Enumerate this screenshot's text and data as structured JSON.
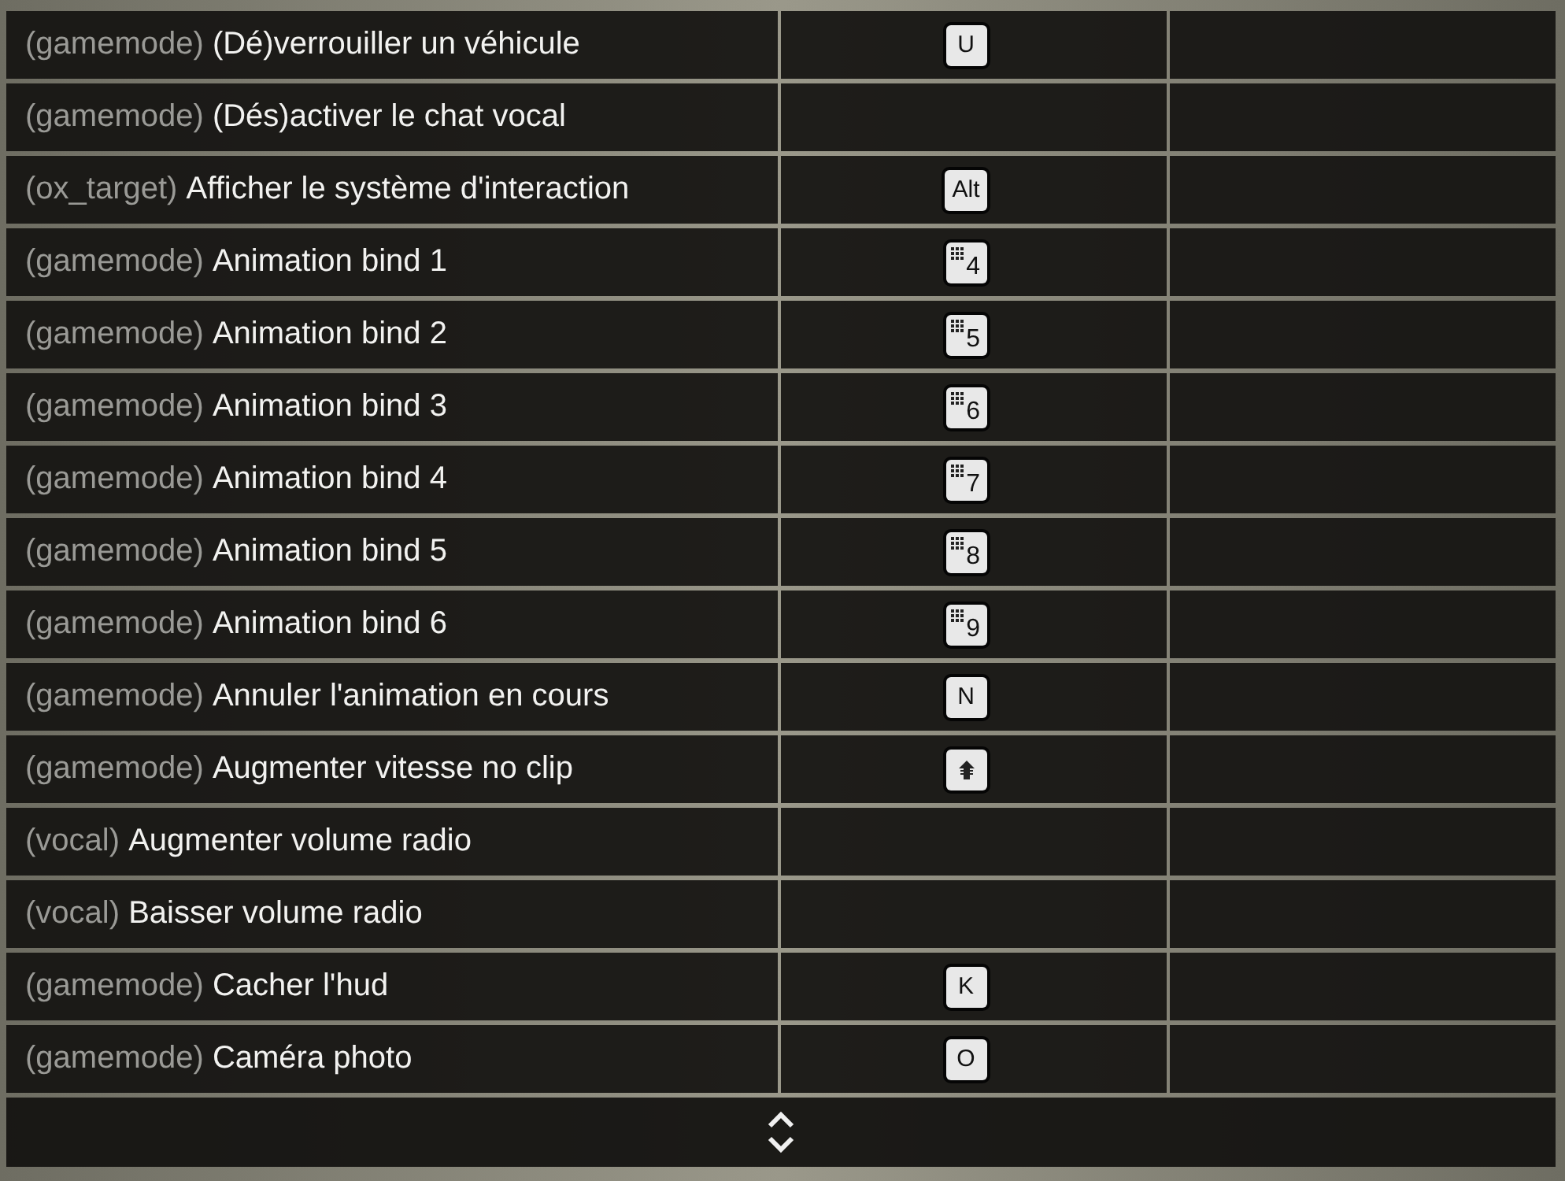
{
  "rows": [
    {
      "source": "(gamemode)",
      "action": "(Dé)verrouiller un véhicule",
      "key": {
        "kind": "key",
        "label": "U"
      }
    },
    {
      "source": "(gamemode)",
      "action": "(Dés)activer le chat vocal"
    },
    {
      "source": "(ox_target)",
      "action": "Afficher le système d'interaction",
      "key": {
        "kind": "key",
        "label": "Alt"
      }
    },
    {
      "source": "(gamemode)",
      "action": "Animation bind 1",
      "key": {
        "kind": "numpad",
        "label": "4"
      }
    },
    {
      "source": "(gamemode)",
      "action": "Animation bind 2",
      "key": {
        "kind": "numpad",
        "label": "5"
      }
    },
    {
      "source": "(gamemode)",
      "action": "Animation bind 3",
      "key": {
        "kind": "numpad",
        "label": "6"
      }
    },
    {
      "source": "(gamemode)",
      "action": "Animation bind 4",
      "key": {
        "kind": "numpad",
        "label": "7"
      }
    },
    {
      "source": "(gamemode)",
      "action": "Animation bind 5",
      "key": {
        "kind": "numpad",
        "label": "8"
      }
    },
    {
      "source": "(gamemode)",
      "action": "Animation bind 6",
      "key": {
        "kind": "numpad",
        "label": "9"
      }
    },
    {
      "source": "(gamemode)",
      "action": "Annuler l'animation en cours",
      "key": {
        "kind": "key",
        "label": "N"
      }
    },
    {
      "source": "(gamemode)",
      "action": "Augmenter vitesse no clip",
      "key": {
        "kind": "shift"
      }
    },
    {
      "source": "(vocal)",
      "action": "Augmenter volume radio"
    },
    {
      "source": "(vocal)",
      "action": "Baisser volume radio"
    },
    {
      "source": "(gamemode)",
      "action": "Cacher l'hud",
      "key": {
        "kind": "key",
        "label": "K"
      }
    },
    {
      "source": "(gamemode)",
      "action": "Caméra photo",
      "key": {
        "kind": "key",
        "label": "O"
      }
    }
  ]
}
